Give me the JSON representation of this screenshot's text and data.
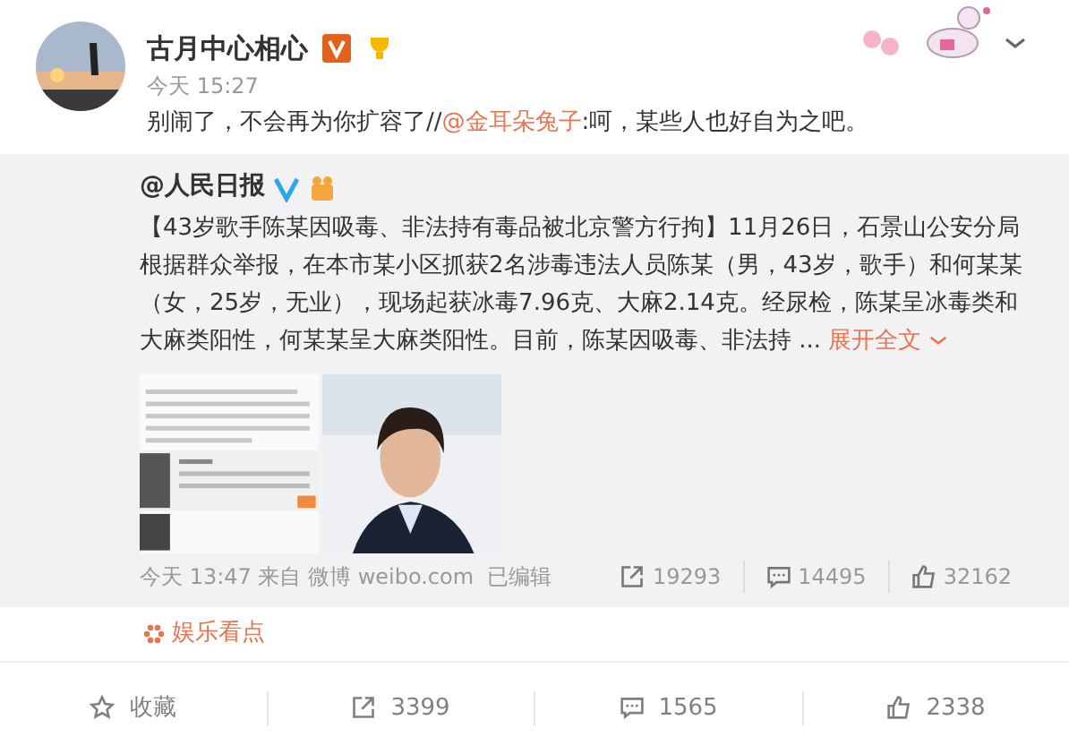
{
  "post": {
    "author": "古月中心相心",
    "time": "今天 15:27",
    "text_before": "别闹了，不会再为你扩容了//",
    "mention": "@金耳朵兔子",
    "text_after": ":呵，某些人也好自为之吧。"
  },
  "repost": {
    "author": "@人民日报",
    "text": "【43岁歌手陈某因吸毒、非法持有毒品被北京警方行拘】11月26日，石景山公安分局根据群众举报，在本市某小区抓获2名涉毒违法人员陈某（男，43岁，歌手）和何某某（女，25岁，无业），现场起获冰毒7.96克、大麻2.14克。经尿检，陈某呈冰毒类和大麻类阳性，何某某呈大麻类阳性。目前，陈某因吸毒、非法持 ...",
    "expand": "展开全文",
    "images": [
      {
        "kind": "screenshot"
      },
      {
        "kind": "picture"
      }
    ],
    "meta": "今天 13:47 来自 微博 weibo.com  已编辑",
    "stats": [
      {
        "kind": "share",
        "count": "19293"
      },
      {
        "kind": "comment",
        "count": "14495"
      },
      {
        "kind": "like",
        "count": "32162"
      }
    ]
  },
  "topic": "娱乐看点",
  "actions": [
    {
      "kind": "favorite",
      "label": "收藏"
    },
    {
      "kind": "share",
      "label": "3399"
    },
    {
      "kind": "comment",
      "label": "1565"
    },
    {
      "kind": "like",
      "label": "2338"
    }
  ]
}
